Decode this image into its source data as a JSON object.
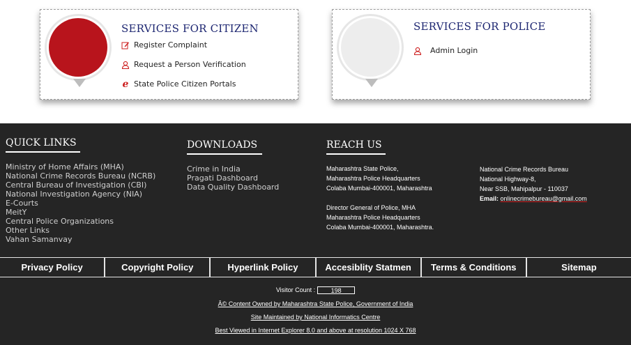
{
  "citizen": {
    "title": "SERVICES FOR CITIZEN",
    "items": [
      {
        "label": "Register Complaint",
        "icon": "edit-icon"
      },
      {
        "label": "Request a Person Verification",
        "icon": "user-icon"
      },
      {
        "label": "State Police Citizen Portals",
        "icon": "internet-explorer-icon"
      }
    ]
  },
  "police": {
    "title": "SERVICES FOR POLICE",
    "items": [
      {
        "label": "Admin Login",
        "icon": "user-icon"
      }
    ]
  },
  "quick_links": {
    "title": "QUICK LINKS",
    "items": [
      "Ministry of Home Affairs (MHA)",
      "National Crime Records Bureau (NCRB)",
      "Central Bureau of Investigation (CBI)",
      "National Investigation Agency (NIA)",
      "E-Courts",
      "MeitY",
      "Central Police Organizations",
      "Other Links",
      "Vahan Samanvay"
    ]
  },
  "downloads": {
    "title": "DOWNLOADS",
    "items": [
      "Crime in India",
      "Pragati Dashboard",
      "Data Quality Dashboard"
    ]
  },
  "reach_us": {
    "title": "REACH US",
    "address1": [
      "Maharashtra State Police,",
      "Maharashtra Police Headquarters",
      "Colaba Mumbai-400001, Maharashtra"
    ],
    "address2": [
      "Director General of Police, MHA",
      "Maharashtra Police Headquarters",
      "Colaba Mumbai-400001, Maharashtra."
    ],
    "address3": [
      "National Crime Records Bureau",
      "National Highway-8,",
      "Near SSB, Mahipalpur - 110037"
    ],
    "email_label": "Email:",
    "email": "onlinecrimebureau@gmail.com"
  },
  "nav": [
    "Privacy Policy",
    "Copyright Policy",
    "Hyperlink Policy",
    "Accesiblity Statmen",
    "Terms & Conditions",
    "Sitemap"
  ],
  "bottom": {
    "visitor_label": "Visitor Count :",
    "visitor_count": "198",
    "content_owned": "Â© Content Owned by Maharashtra State Police, Government of India",
    "maintained": "Site Maintained by National Informatics Centre",
    "best_viewed": "Best Viewed in Internet Explorer 8.0 and above at resolution 1024 X 768"
  },
  "colors": {
    "accent_red": "#b8141c",
    "title_blue": "#1d2671",
    "footer_bg": "#252525"
  }
}
